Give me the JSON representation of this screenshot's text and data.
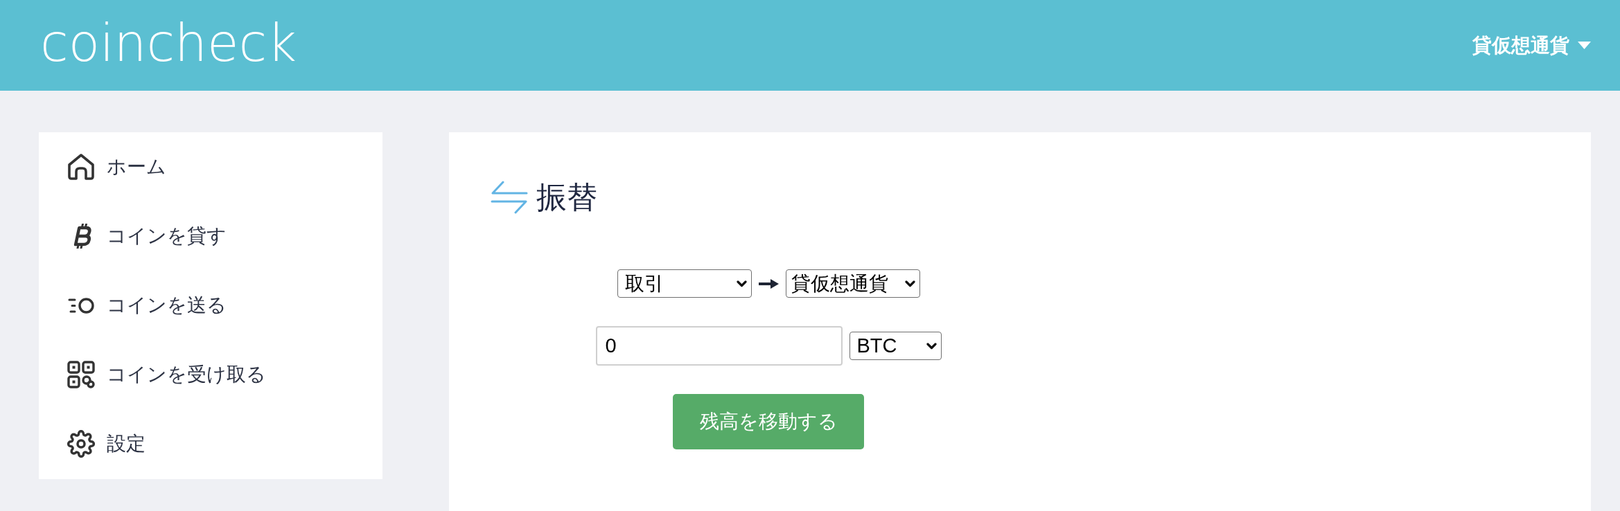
{
  "header": {
    "logo": "coincheck",
    "account_menu": {
      "label": "貸仮想通貨"
    }
  },
  "sidebar": {
    "items": [
      {
        "label": "ホーム"
      },
      {
        "label": "コインを貸す"
      },
      {
        "label": "コインを送る"
      },
      {
        "label": "コインを受け取る"
      },
      {
        "label": "設定"
      }
    ]
  },
  "main": {
    "title": "振替",
    "transfer_form": {
      "from_select": {
        "value": "取引"
      },
      "to_select": {
        "value": "貸仮想通貨"
      },
      "amount_field": {
        "value": "0"
      },
      "currency_select": {
        "value": "BTC"
      },
      "submit_button": {
        "label": "残高を移動する"
      }
    }
  }
}
